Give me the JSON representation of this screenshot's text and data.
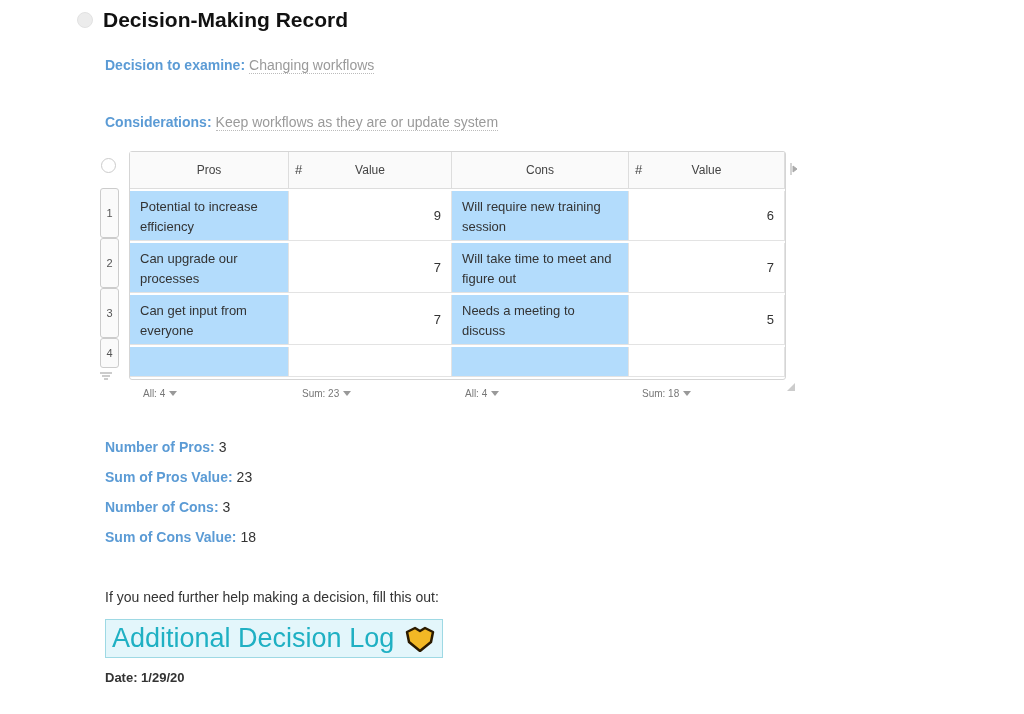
{
  "title": "Decision-Making Record",
  "fields": [
    {
      "label": "Decision to examine:",
      "value": "Changing workflows"
    },
    {
      "label": "Considerations:",
      "value": "Keep workflows as they are or update system"
    }
  ],
  "table": {
    "columns": [
      {
        "name": "Pros",
        "kind": "text",
        "highlighted": true
      },
      {
        "name": "Value",
        "kind": "number",
        "type_glyph": "#",
        "highlighted": false
      },
      {
        "name": "Cons",
        "kind": "text",
        "highlighted": true
      },
      {
        "name": "Value",
        "kind": "number",
        "type_glyph": "#",
        "highlighted": false
      }
    ],
    "rows": [
      {
        "number": "1",
        "cells": [
          "Potential to increase efficiency",
          "9",
          "Will require new training session",
          "6"
        ]
      },
      {
        "number": "2",
        "cells": [
          "Can upgrade our processes",
          "7",
          "Will take time to meet and figure out",
          "7"
        ]
      },
      {
        "number": "3",
        "cells": [
          "Can get input from everyone",
          "7",
          "Needs a meeting to discuss",
          "5"
        ]
      },
      {
        "number": "4"
      }
    ],
    "footer": [
      "All: 4",
      "Sum: 23",
      "All: 4",
      "Sum: 18"
    ]
  },
  "summary": [
    {
      "label": "Number of Pros:",
      "value": "3"
    },
    {
      "label": "Sum of Pros Value:",
      "value": "23"
    },
    {
      "label": "Number of Cons:",
      "value": "3"
    },
    {
      "label": "Sum of Cons Value:",
      "value": "18"
    }
  ],
  "prompt": "If you need further help making a decision, fill this out:",
  "link": {
    "label": "Additional Decision Log"
  },
  "date": "Date: 1/29/20"
}
